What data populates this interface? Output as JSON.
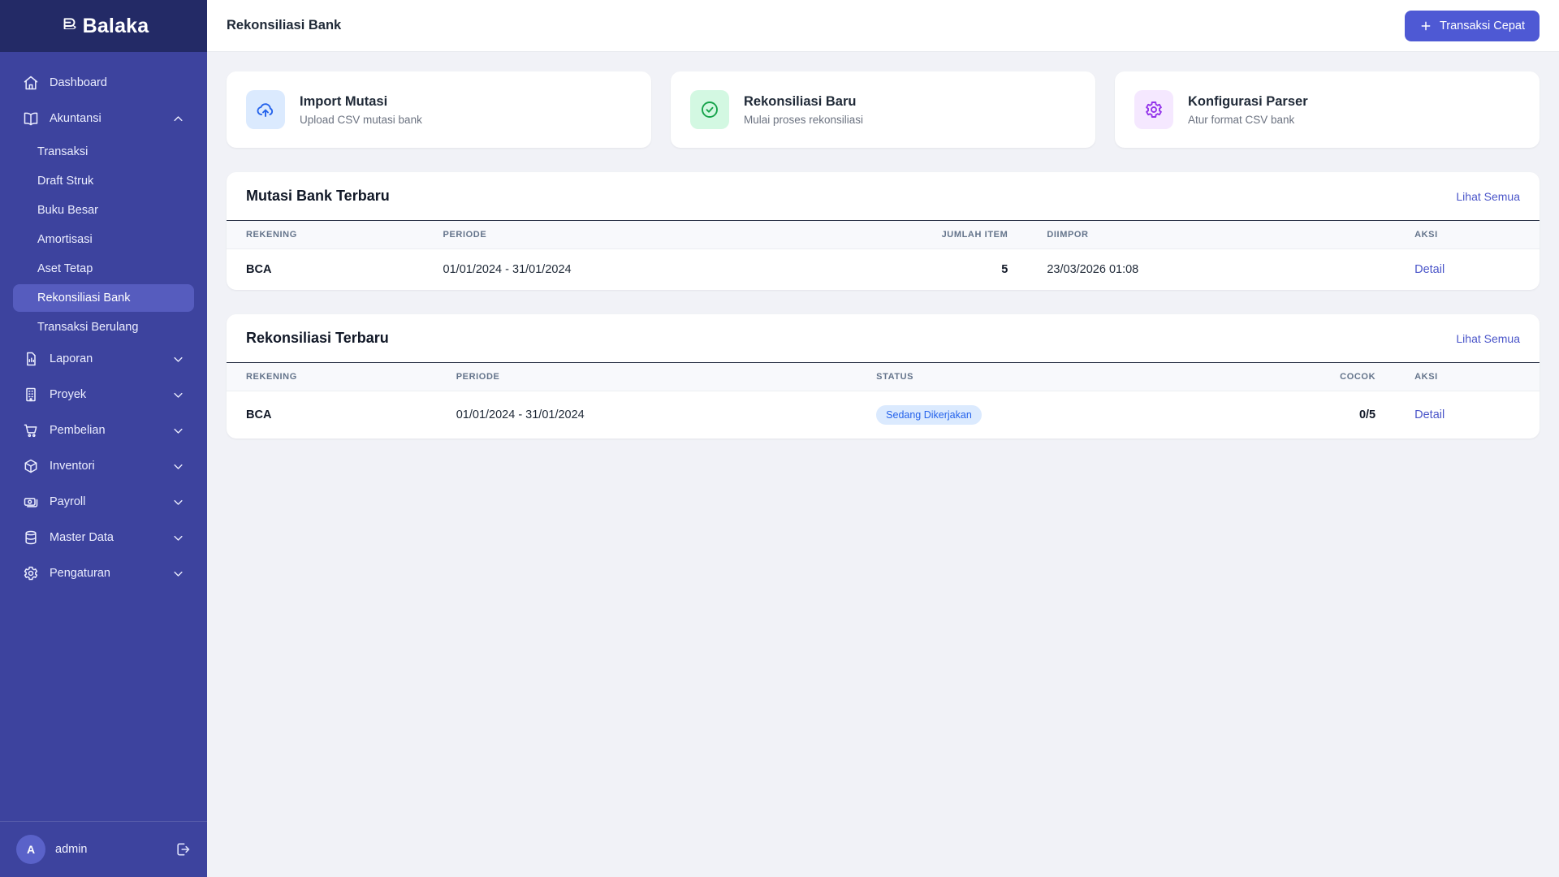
{
  "app": {
    "logo_text": "Balaka"
  },
  "sidebar": {
    "items": [
      {
        "label": "Dashboard",
        "icon": "home-icon"
      },
      {
        "label": "Akuntansi",
        "icon": "book-open-icon",
        "expanded": true,
        "children": [
          "Transaksi",
          "Draft Struk",
          "Buku Besar",
          "Amortisasi",
          "Aset Tetap",
          "Rekonsiliasi Bank",
          "Transaksi Berulang"
        ],
        "active_child": "Rekonsiliasi Bank"
      },
      {
        "label": "Laporan",
        "icon": "report-icon"
      },
      {
        "label": "Proyek",
        "icon": "building-icon"
      },
      {
        "label": "Pembelian",
        "icon": "cart-icon"
      },
      {
        "label": "Inventori",
        "icon": "cube-icon"
      },
      {
        "label": "Payroll",
        "icon": "banknotes-icon"
      },
      {
        "label": "Master Data",
        "icon": "database-icon"
      },
      {
        "label": "Pengaturan",
        "icon": "gear-icon"
      }
    ],
    "user": {
      "initial": "A",
      "name": "admin"
    }
  },
  "header": {
    "title": "Rekonsiliasi Bank",
    "quick_button": "Transaksi Cepat"
  },
  "action_cards": [
    {
      "title": "Import Mutasi",
      "subtitle": "Upload CSV mutasi bank",
      "icon": "cloud-upload-icon",
      "icon_color": "#2563eb",
      "icon_bg": "#dbeafe"
    },
    {
      "title": "Rekonsiliasi Baru",
      "subtitle": "Mulai proses rekonsiliasi",
      "icon": "check-circle-icon",
      "icon_color": "#16a34a",
      "icon_bg": "#d3f8e2"
    },
    {
      "title": "Konfigurasi Parser",
      "subtitle": "Atur format CSV bank",
      "icon": "gear-icon",
      "icon_color": "#9333ea",
      "icon_bg": "#f5e8ff"
    }
  ],
  "mutasi_section": {
    "title": "Mutasi Bank Terbaru",
    "link": "Lihat Semua",
    "columns": [
      "REKENING",
      "PERIODE",
      "JUMLAH ITEM",
      "DIIMPOR",
      "AKSI"
    ],
    "rows": [
      {
        "rekening": "BCA",
        "periode": "01/01/2024 - 31/01/2024",
        "jumlah_item": "5",
        "diimpor": "23/03/2026 01:08",
        "aksi": "Detail"
      }
    ]
  },
  "rekonsiliasi_section": {
    "title": "Rekonsiliasi Terbaru",
    "link": "Lihat Semua",
    "columns": [
      "REKENING",
      "PERIODE",
      "STATUS",
      "COCOK",
      "AKSI"
    ],
    "rows": [
      {
        "rekening": "BCA",
        "periode": "01/01/2024 - 31/01/2024",
        "status": "Sedang Dikerjakan",
        "cocok": "0/5",
        "aksi": "Detail"
      }
    ]
  },
  "colors": {
    "sidebar_bg": "#3d439e",
    "sidebar_top_bg": "#232a66",
    "active_item_bg": "#565cbe",
    "accent_button": "#4e59d4",
    "link": "#4a55c9",
    "badge_bg": "#dbeafe",
    "badge_text": "#2563eb",
    "content_bg": "#f1f2f7"
  }
}
